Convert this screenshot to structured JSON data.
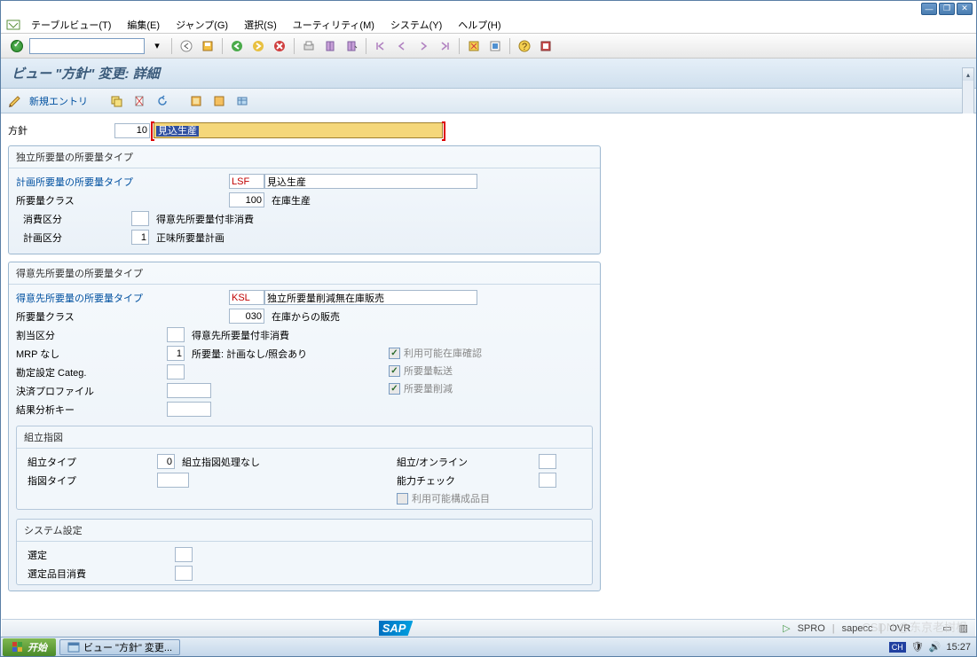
{
  "menu": {
    "table_view": "テーブルビュー(T)",
    "edit": "編集(E)",
    "jump": "ジャンプ(G)",
    "select": "選択(S)",
    "utility": "ユーティリティ(M)",
    "system": "システム(Y)",
    "help": "ヘルプ(H)"
  },
  "page_title": "ビュー \"方針\" 変更: 詳細",
  "app_toolbar": {
    "new_entry": "新規エントリ"
  },
  "header": {
    "label": "方針",
    "code": "10",
    "desc": "見込生産"
  },
  "group1": {
    "title": "独立所要量の所要量タイプ",
    "plan_type_label": "計画所要量の所要量タイプ",
    "plan_type_code": "LSF",
    "plan_type_desc": "見込生産",
    "class_label": "所要量クラス",
    "class_code": "100",
    "class_desc": "在庫生産",
    "consume_label": "消費区分",
    "consume_val": "",
    "consume_desc": "得意先所要量付非消費",
    "plan_seg_label": "計画区分",
    "plan_seg_val": "1",
    "plan_seg_desc": "正味所要量計画"
  },
  "group2": {
    "title": "得意先所要量の所要量タイプ",
    "cust_type_label": "得意先所要量の所要量タイプ",
    "cust_type_code": "KSL",
    "cust_type_desc": "独立所要量削減無在庫販売",
    "class_label": "所要量クラス",
    "class_code": "030",
    "class_desc": "在庫からの販売",
    "alloc_label": "割当区分",
    "alloc_val": "",
    "alloc_desc": "得意先所要量付非消費",
    "mrp_label": "MRP なし",
    "mrp_val": "1",
    "mrp_desc": "所要量: 計画なし/照会あり",
    "acct_label": "勘定設定 Categ.",
    "settle_label": "決済プロファイル",
    "result_label": "結果分析キー",
    "chk1": "利用可能在庫確認",
    "chk2": "所要量転送",
    "chk3": "所要量削減",
    "assembly": {
      "title": "組立指図",
      "atype_label": "組立タイプ",
      "atype_val": "0",
      "atype_desc": "組立指図処理なし",
      "otype_label": "指図タイプ",
      "online_label": "組立/オンライン",
      "cap_label": "能力チェック",
      "config_label": "利用可能構成品目"
    },
    "system": {
      "title": "システム設定",
      "sel_label": "選定",
      "sel_item_label": "選定品目消費"
    }
  },
  "status": {
    "tcode": "SPRO",
    "system": "sapecc",
    "mode": "OVR"
  },
  "taskbar": {
    "start": "开始",
    "task1": "ビュー \"方針\" 変更...",
    "lang": "CH",
    "time": "15:27"
  },
  "watermark": "CSDN @东京老树根"
}
